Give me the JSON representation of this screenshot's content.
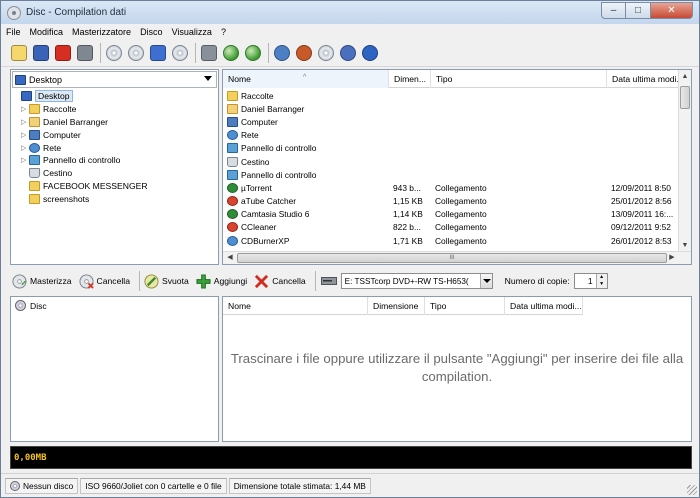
{
  "window": {
    "title": "Disc - Compilation dati",
    "minimize": "–",
    "maximize": "□",
    "close": "✕"
  },
  "menu": [
    "File",
    "Modifica",
    "Masterizzatore",
    "Disco",
    "Visualizza",
    "?"
  ],
  "toolbar_icons": [
    {
      "name": "new-project-icon",
      "color": "#f5d76b"
    },
    {
      "name": "save-icon",
      "color": "#3a63b8"
    },
    {
      "name": "delete-icon",
      "color": "#d62f22"
    },
    {
      "name": "print-icon",
      "color": "#7f8791"
    },
    {
      "name": "burn-disc-icon",
      "color": "#d9dde2"
    },
    {
      "name": "erase-disc-icon",
      "color": "#d9dde2"
    },
    {
      "name": "blue-square-icon",
      "color": "#3e6fd0"
    },
    {
      "name": "disc-info-icon",
      "color": "#d9dde2"
    },
    {
      "name": "drive-icon",
      "color": "#8a9099"
    },
    {
      "name": "globe-green-icon",
      "color": "#3b9a31"
    },
    {
      "name": "globe-green-2-icon",
      "color": "#3b9a31"
    },
    {
      "name": "settings-gear-icon",
      "color": "#4d7fc4"
    },
    {
      "name": "tools-icon",
      "color": "#c85a2a"
    },
    {
      "name": "search-disc-icon",
      "color": "#2f7a6b"
    },
    {
      "name": "help-icon",
      "color": "#4b6fbf"
    },
    {
      "name": "info-icon",
      "color": "#2d64c4"
    }
  ],
  "left_pane": {
    "combo_value": "Desktop",
    "tree": [
      {
        "label": "Desktop",
        "icon": "desktop-icon",
        "cls": "ico-desk",
        "level": 0,
        "exp": "",
        "selected": true
      },
      {
        "label": "Raccolte",
        "icon": "folder-icon",
        "cls": "ico-folder",
        "level": 1,
        "exp": "▷"
      },
      {
        "label": "Daniel Barranger",
        "icon": "user-folder-icon",
        "cls": "ico-user",
        "level": 1,
        "exp": "▷"
      },
      {
        "label": "Computer",
        "icon": "computer-icon",
        "cls": "ico-comp",
        "level": 1,
        "exp": "▷"
      },
      {
        "label": "Rete",
        "icon": "network-icon",
        "cls": "ico-net",
        "level": 1,
        "exp": "▷"
      },
      {
        "label": "Pannello di controllo",
        "icon": "control-panel-icon",
        "cls": "ico-ctrl",
        "level": 1,
        "exp": "▷"
      },
      {
        "label": "Cestino",
        "icon": "recycle-bin-icon",
        "cls": "ico-bin",
        "level": 1,
        "exp": ""
      },
      {
        "label": "FACEBOOK MESSENGER",
        "icon": "folder-icon",
        "cls": "ico-folder",
        "level": 1,
        "exp": ""
      },
      {
        "label": "screenshots",
        "icon": "folder-icon",
        "cls": "ico-folder",
        "level": 1,
        "exp": ""
      }
    ]
  },
  "file_pane": {
    "headers": [
      "Nome",
      "Dimen...",
      "Tipo",
      "Data ultima modi..."
    ],
    "rows": [
      {
        "name": "Raccolte",
        "size": "",
        "type": "",
        "date": "",
        "cls": "ico-folder"
      },
      {
        "name": "Daniel Barranger",
        "size": "",
        "type": "",
        "date": "",
        "cls": "ico-user"
      },
      {
        "name": "Computer",
        "size": "",
        "type": "",
        "date": "",
        "cls": "ico-comp"
      },
      {
        "name": "Rete",
        "size": "",
        "type": "",
        "date": "",
        "cls": "ico-net"
      },
      {
        "name": "Pannello di controllo",
        "size": "",
        "type": "",
        "date": "",
        "cls": "ico-ctrl"
      },
      {
        "name": "Cestino",
        "size": "",
        "type": "",
        "date": "",
        "cls": "ico-bin"
      },
      {
        "name": "Pannello di controllo",
        "size": "",
        "type": "",
        "date": "",
        "cls": "ico-ctrl"
      },
      {
        "name": "µTorrent",
        "size": "943 b...",
        "type": "Collegamento",
        "date": "12/09/2011 8:50",
        "cls": "ico-app"
      },
      {
        "name": "aTube Catcher",
        "size": "1,15 KB",
        "type": "Collegamento",
        "date": "25/01/2012 8:56",
        "cls": "ico-red"
      },
      {
        "name": "Camtasia Studio 6",
        "size": "1,14 KB",
        "type": "Collegamento",
        "date": "13/09/2011 16:...",
        "cls": "ico-app"
      },
      {
        "name": "CCleaner",
        "size": "822 b...",
        "type": "Collegamento",
        "date": "09/12/2011 9:52",
        "cls": "ico-red"
      },
      {
        "name": "CDBurnerXP",
        "size": "1,71 KB",
        "type": "Collegamento",
        "date": "26/01/2012 8:53",
        "cls": "ico-net"
      }
    ],
    "hscroll_grip": "III"
  },
  "toolbar2": {
    "burn": "Masterizza",
    "erase": "Cancella",
    "empty": "Svuota",
    "add": "Aggiungi",
    "remove": "Cancella",
    "drive": "E: TSSTcorp DVD+-RW TS-H653(",
    "copies_label": "Numero di copie:",
    "copies_value": "1"
  },
  "disc_pane": {
    "label": "Disc"
  },
  "compilation_pane": {
    "headers": [
      "Nome",
      "Dimensione",
      "Tipo",
      "Data ultima modi..."
    ],
    "message": "Trascinare i file oppure utilizzare il pulsante \"Aggiungi\" per inserire dei file alla compilation."
  },
  "capacity": {
    "text": "0,00MB"
  },
  "status": {
    "disc": "Nessun disco",
    "format": "ISO 9660/Joliet con 0 cartelle e 0 file",
    "size": "Dimensione totale stimata: 1,44 MB"
  }
}
